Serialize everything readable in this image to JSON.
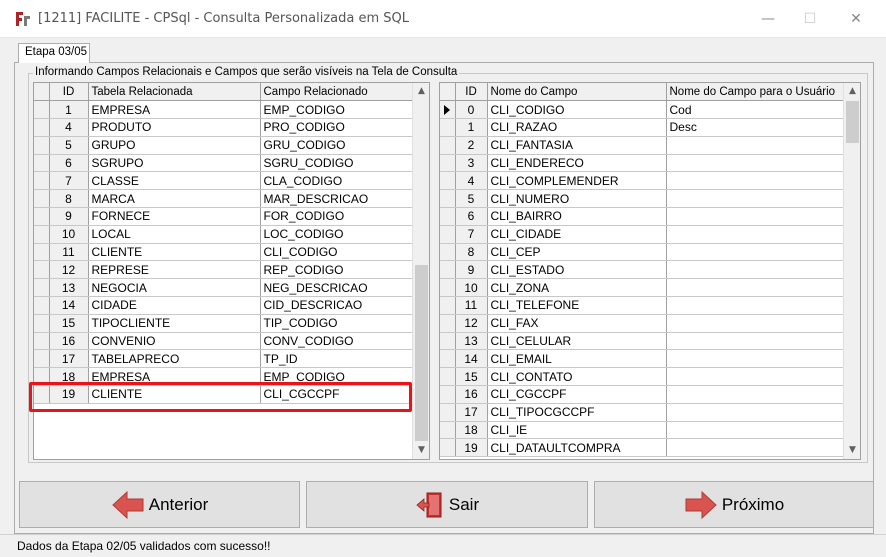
{
  "window": {
    "title": "[1211] FACILITE - CPSql - Consulta Personalizada em SQL",
    "minimize": "—",
    "maximize": "☐",
    "close": "✕"
  },
  "tab": {
    "label": "Etapa 03/05"
  },
  "group": {
    "label": "Informando Campos Relacionais e Campos que serão visíveis na Tela de Consulta"
  },
  "left_grid": {
    "columns": [
      "ID",
      "Tabela Relacionada",
      "Campo Relacionado"
    ],
    "current_row": 18,
    "rows": [
      [
        "1",
        "EMPRESA",
        "EMP_CODIGO"
      ],
      [
        "4",
        "PRODUTO",
        "PRO_CODIGO"
      ],
      [
        "5",
        "GRUPO",
        "GRU_CODIGO"
      ],
      [
        "6",
        "SGRUPO",
        "SGRU_CODIGO"
      ],
      [
        "7",
        "CLASSE",
        "CLA_CODIGO"
      ],
      [
        "8",
        "MARCA",
        "MAR_DESCRICAO"
      ],
      [
        "9",
        "FORNECE",
        "FOR_CODIGO"
      ],
      [
        "10",
        "LOCAL",
        "LOC_CODIGO"
      ],
      [
        "11",
        "CLIENTE",
        "CLI_CODIGO"
      ],
      [
        "12",
        "REPRESE",
        "REP_CODIGO"
      ],
      [
        "13",
        "NEGOCIA",
        "NEG_DESCRICAO"
      ],
      [
        "14",
        "CIDADE",
        "CID_DESCRICAO"
      ],
      [
        "15",
        "TIPOCLIENTE",
        "TIP_CODIGO"
      ],
      [
        "16",
        "CONVENIO",
        "CONV_CODIGO"
      ],
      [
        "17",
        "TABELAPRECO",
        "TP_ID"
      ],
      [
        "18",
        "EMPRESA",
        "EMP_CODIGO"
      ],
      [
        "19",
        "CLIENTE",
        "CLI_CGCCPF"
      ]
    ]
  },
  "right_grid": {
    "columns": [
      "ID",
      "Nome do Campo",
      "Nome do Campo para o Usuário"
    ],
    "current_row": 0,
    "rows": [
      [
        "0",
        "CLI_CODIGO",
        "Cod"
      ],
      [
        "1",
        "CLI_RAZAO",
        "Desc"
      ],
      [
        "2",
        "CLI_FANTASIA",
        ""
      ],
      [
        "3",
        "CLI_ENDERECO",
        ""
      ],
      [
        "4",
        "CLI_COMPLEMENDER",
        ""
      ],
      [
        "5",
        "CLI_NUMERO",
        ""
      ],
      [
        "6",
        "CLI_BAIRRO",
        ""
      ],
      [
        "7",
        "CLI_CIDADE",
        ""
      ],
      [
        "8",
        "CLI_CEP",
        ""
      ],
      [
        "9",
        "CLI_ESTADO",
        ""
      ],
      [
        "10",
        "CLI_ZONA",
        ""
      ],
      [
        "11",
        "CLI_TELEFONE",
        ""
      ],
      [
        "12",
        "CLI_FAX",
        ""
      ],
      [
        "13",
        "CLI_CELULAR",
        ""
      ],
      [
        "14",
        "CLI_EMAIL",
        ""
      ],
      [
        "15",
        "CLI_CONTATO",
        ""
      ],
      [
        "16",
        "CLI_CGCCPF",
        ""
      ],
      [
        "17",
        "CLI_TIPOCGCCPF",
        ""
      ],
      [
        "18",
        "CLI_IE",
        ""
      ],
      [
        "19",
        "CLI_DATAULTCOMPRA",
        ""
      ]
    ]
  },
  "buttons": {
    "anterior": "Anterior",
    "sair": "Sair",
    "proximo": "Próximo"
  },
  "status": {
    "text": "Dados da Etapa 02/05 validados com sucesso!!"
  },
  "colors": {
    "highlight": "#e8141a",
    "nav_arrow": "#d9534f"
  }
}
